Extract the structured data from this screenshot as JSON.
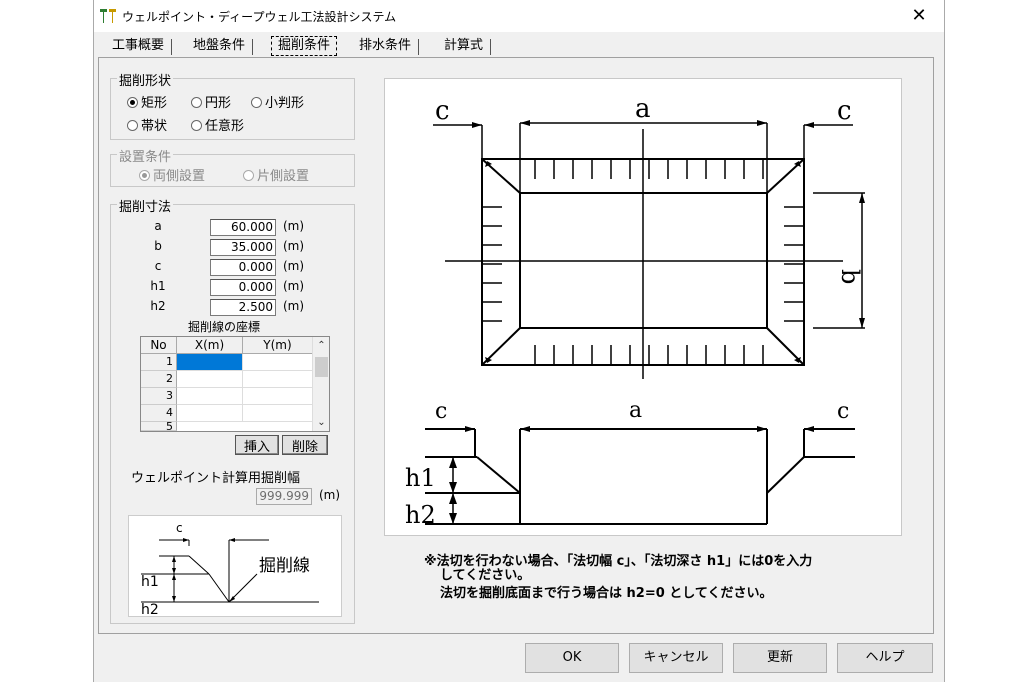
{
  "window": {
    "title": "ウェルポイント・ディープウェル工法設計システム",
    "close": "✕"
  },
  "tabs": [
    "工事概要",
    "地盤条件",
    "掘削条件",
    "排水条件",
    "計算式"
  ],
  "active_tab": "掘削条件",
  "shape_group": {
    "legend": "掘削形状",
    "options": [
      "矩形",
      "円形",
      "小判形",
      "帯状",
      "任意形"
    ],
    "selected": "矩形"
  },
  "install_group": {
    "legend": "設置条件",
    "options": [
      "両側設置",
      "片側設置"
    ],
    "selected": "両側設置"
  },
  "dim_group": {
    "legend": "掘削寸法",
    "rows": [
      {
        "label": "a",
        "value": "60.000",
        "unit": "(m)"
      },
      {
        "label": "b",
        "value": "35.000",
        "unit": "(m)"
      },
      {
        "label": "c",
        "value": "0.000",
        "unit": "(m)"
      },
      {
        "label": "h1",
        "value": "0.000",
        "unit": "(m)"
      },
      {
        "label": "h2",
        "value": "2.500",
        "unit": "(m)"
      }
    ],
    "coords_title": "掘削線の座標",
    "grid_headers": [
      "No",
      "X(m)",
      "Y(m)"
    ],
    "grid_rows": [
      "1",
      "2",
      "3",
      "4",
      "5"
    ],
    "insert_button": "挿入",
    "delete_button": "削除",
    "width_label": "ウェルポイント計算用掘削幅",
    "width_value": "999.999",
    "width_unit": "(m)"
  },
  "small_diagram": {
    "label_c": "c",
    "label_line": "掘削線",
    "label_h1": "h1",
    "label_h2": "h2"
  },
  "main_diagram": {
    "top_a": "a",
    "top_c_left": "c",
    "top_c_right": "c",
    "side_b": "b",
    "sec_a": "a",
    "sec_c_left": "c",
    "sec_c_right": "c",
    "sec_h1": "h1",
    "sec_h2": "h2"
  },
  "notes": {
    "line1": "※法切を行わない場合、「法切幅 c」、「法切深さ h1」には0を入力",
    "line2": "してください。",
    "line3": "法切を掘削底面まで行う場合は h2=0 としてください。"
  },
  "footer": {
    "ok": "OK",
    "cancel": "キャンセル",
    "update": "更新",
    "help": "ヘルプ"
  }
}
